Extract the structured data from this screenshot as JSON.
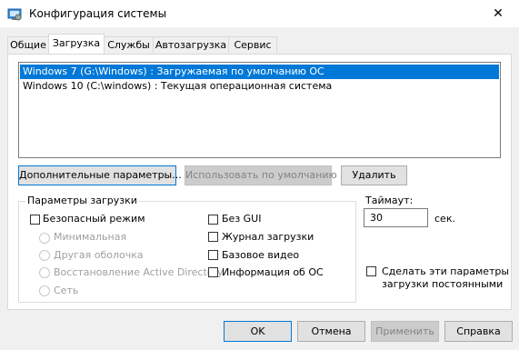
{
  "window": {
    "title": "Конфигурация системы",
    "close_glyph": "✕"
  },
  "tabs": [
    {
      "label": "Общие"
    },
    {
      "label": "Загрузка",
      "active": true
    },
    {
      "label": "Службы"
    },
    {
      "label": "Автозагрузка"
    },
    {
      "label": "Сервис"
    }
  ],
  "os_list": [
    {
      "text": "Windows 7 (G:\\Windows) : Загружаемая по умолчанию ОС",
      "selected": true
    },
    {
      "text": "Windows 10 (C:\\windows) : Текущая операционная система",
      "selected": false
    }
  ],
  "buttons": {
    "advanced": "Дополнительные параметры...",
    "set_default": "Использовать по умолчанию",
    "delete": "Удалить"
  },
  "boot_options": {
    "group_label": "Параметры загрузки",
    "safe_mode": "Безопасный режим",
    "minimal": "Минимальная",
    "alternate_shell": "Другая оболочка",
    "ad_repair": "Восстановление Active Directory",
    "network": "Сеть",
    "no_gui": "Без GUI",
    "boot_log": "Журнал загрузки",
    "base_video": "Базовое видео",
    "os_info": "Информация  об ОС"
  },
  "timeout": {
    "label": "Таймаут:",
    "value": "30",
    "unit": "сек."
  },
  "permanent": {
    "label_line1": "Сделать эти параметры",
    "label_line2": "загрузки постоянными"
  },
  "footer": {
    "ok": "OK",
    "cancel": "Отмена",
    "apply": "Применить",
    "help": "Справка"
  },
  "colors": {
    "selection": "#0078d7",
    "window_bg": "#f0f0f0",
    "accent_border": "#0078d7"
  }
}
